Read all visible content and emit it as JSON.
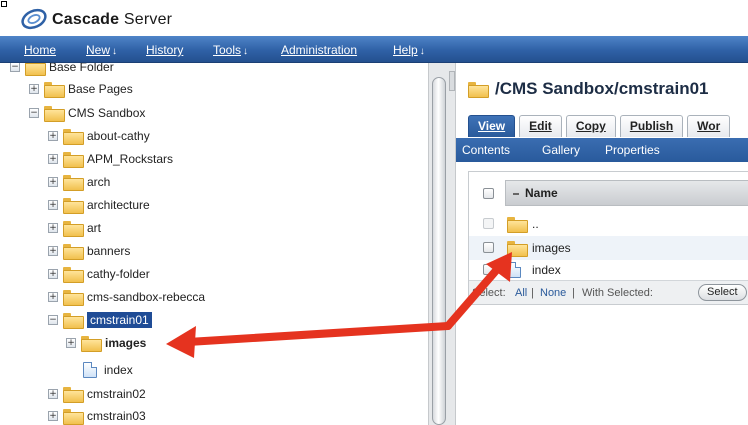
{
  "header": {
    "logo_bold": "Cascade",
    "logo_light": "Server"
  },
  "nav": {
    "items": [
      {
        "label": "Home",
        "has_menu": false
      },
      {
        "label": "New",
        "has_menu": true
      },
      {
        "label": "History",
        "has_menu": false
      },
      {
        "label": "Tools",
        "has_menu": true
      },
      {
        "label": "Administration",
        "has_menu": false
      },
      {
        "label": "Help",
        "has_menu": true
      }
    ]
  },
  "tree": {
    "root_label": "Base Folder",
    "items": [
      {
        "label": "Base Pages",
        "expander": "+"
      },
      {
        "label": "CMS Sandbox",
        "expander": "−"
      },
      {
        "label": "about-cathy",
        "expander": "+"
      },
      {
        "label": "APM_Rockstars",
        "expander": "+"
      },
      {
        "label": "arch",
        "expander": "+"
      },
      {
        "label": "architecture",
        "expander": "+"
      },
      {
        "label": "art",
        "expander": "+"
      },
      {
        "label": "banners",
        "expander": "+"
      },
      {
        "label": "cathy-folder",
        "expander": "+"
      },
      {
        "label": "cms-sandbox-rebecca",
        "expander": "+"
      },
      {
        "label": "cmstrain01",
        "expander": "−",
        "selected": true
      },
      {
        "label": "images",
        "expander": "+"
      },
      {
        "label": "index",
        "expander": "",
        "type": "page"
      },
      {
        "label": "cmstrain02",
        "expander": "+"
      },
      {
        "label": "cmstrain03",
        "expander": "+"
      }
    ]
  },
  "content": {
    "path_title": "/CMS Sandbox/cmstrain01",
    "tabs": [
      {
        "label": "View",
        "active": true
      },
      {
        "label": "Edit",
        "active": false
      },
      {
        "label": "Copy",
        "active": false
      },
      {
        "label": "Publish",
        "active": false
      },
      {
        "label": "Wor",
        "active": false
      }
    ],
    "subtabs": [
      "Contents",
      "Gallery",
      "Properties"
    ],
    "table": {
      "column_name": "Name",
      "rows": [
        {
          "label": "..",
          "type": "folder"
        },
        {
          "label": "images",
          "type": "folder"
        },
        {
          "label": "index",
          "type": "page"
        }
      ]
    },
    "select_bar": {
      "prefix": "Select:",
      "all": "All",
      "sep1": "|",
      "none": "None",
      "sep2": "|",
      "with_selected": "With Selected:",
      "button": "Select"
    }
  },
  "colors": {
    "nav_blue": "#2f61a6",
    "selection_blue": "#1f4c96",
    "arrow_red": "#e5331f",
    "folder_yellow": "#f1c04d"
  }
}
